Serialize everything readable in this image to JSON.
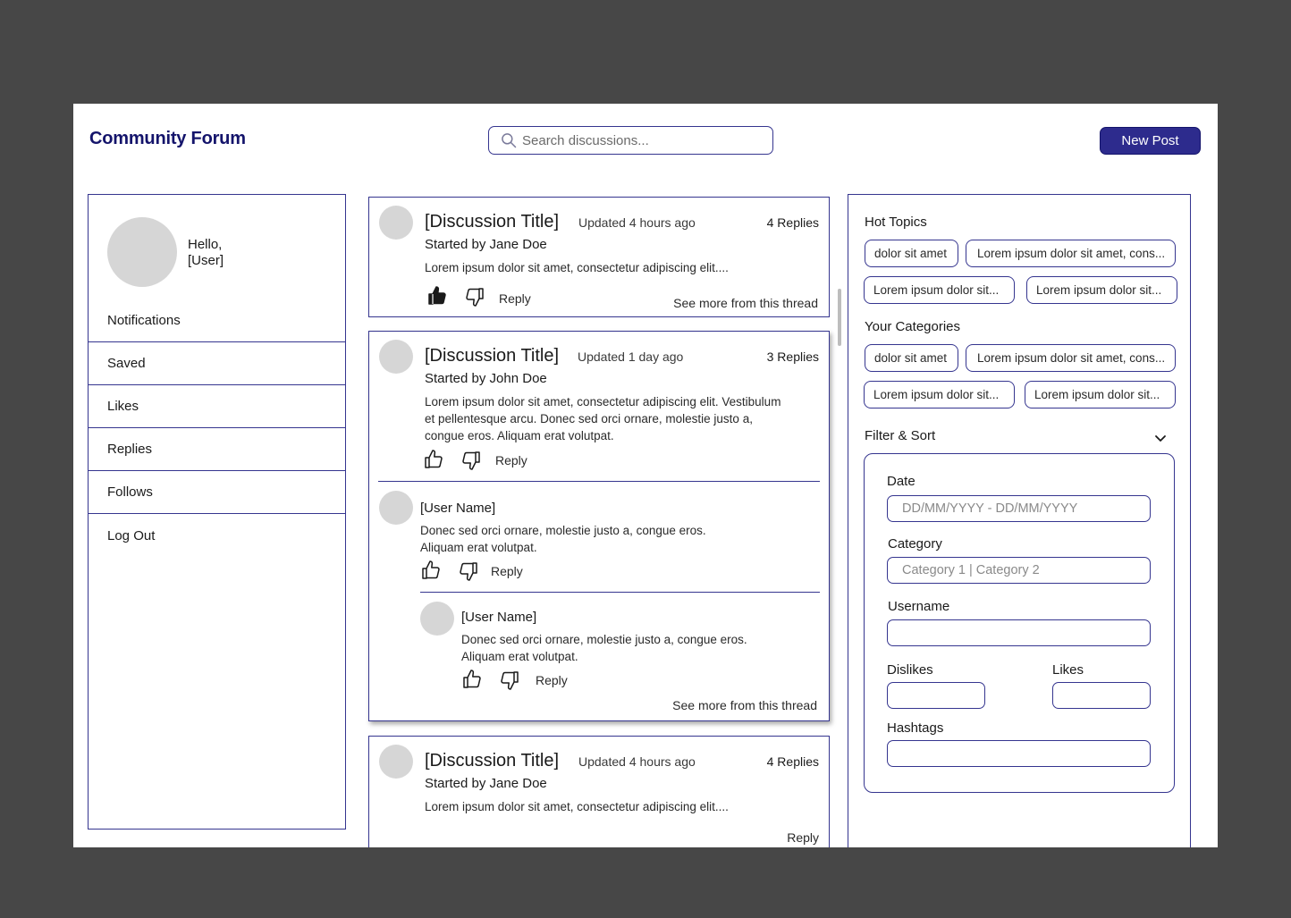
{
  "header": {
    "logo": "Community Forum",
    "search_placeholder": "Search discussions...",
    "new_post_label": "New Post"
  },
  "sidebar": {
    "greeting_line1": "Hello,",
    "greeting_line2": "[User]",
    "items": [
      {
        "label": "Notifications"
      },
      {
        "label": "Saved"
      },
      {
        "label": "Likes"
      },
      {
        "label": "Replies"
      },
      {
        "label": "Follows"
      },
      {
        "label": "Log Out"
      }
    ]
  },
  "posts": [
    {
      "title": "[Discussion Title]",
      "updated": "Updated 4 hours ago",
      "replies": "4 Replies",
      "started_by": "Started by Jane Doe",
      "body": "Lorem ipsum dolor sit amet, consectetur adipiscing elit....",
      "reply_label": "Reply",
      "see_more": "See more from this thread",
      "liked": true
    },
    {
      "title": "[Discussion Title]",
      "updated": "Updated 1 day ago",
      "replies": "3 Replies",
      "started_by": "Started by John Doe",
      "body_lines": [
        "Lorem ipsum dolor sit amet, consectetur adipiscing elit. Vestibulum",
        "et pellentesque arcu. Donec sed orci ornare, molestie justo a,",
        "congue eros. Aliquam erat volutpat."
      ],
      "reply_label": "Reply",
      "comments": [
        {
          "user": "[User Name]",
          "lines": [
            "Donec sed orci ornare, molestie justo a, congue eros.",
            "Aliquam erat volutpat."
          ],
          "reply_label": "Reply"
        },
        {
          "user": "[User Name]",
          "lines": [
            "Donec sed orci ornare, molestie justo a, congue eros.",
            "Aliquam erat volutpat."
          ],
          "reply_label": "Reply"
        }
      ],
      "see_more": "See more from this thread"
    },
    {
      "title": "[Discussion Title]",
      "updated": "Updated 4 hours ago",
      "replies": "4 Replies",
      "started_by": "Started by Jane Doe",
      "body": "Lorem ipsum dolor sit amet, consectetur adipiscing elit....",
      "reply_label": "Reply"
    }
  ],
  "right_panel": {
    "hot_topics_heading": "Hot Topics",
    "hot_topics": [
      "dolor sit amet",
      "Lorem ipsum dolor sit amet, cons...",
      "Lorem ipsum dolor sit...",
      "Lorem ipsum dolor sit..."
    ],
    "categories_heading": "Your Categories",
    "categories": [
      "dolor sit amet",
      "Lorem ipsum dolor sit amet, cons...",
      "Lorem ipsum dolor sit...",
      "Lorem ipsum dolor sit..."
    ],
    "filter_heading": "Filter & Sort",
    "filter": {
      "date_label": "Date",
      "date_placeholder": "DD/MM/YYYY - DD/MM/YYYY",
      "category_label": "Category",
      "category_placeholder": "Category 1 | Category 2",
      "username_label": "Username",
      "dislikes_label": "Dislikes",
      "likes_label": "Likes",
      "hashtags_label": "Hashtags"
    }
  },
  "colors": {
    "background": "#474747",
    "accent": "#2d2b8d",
    "logo": "#14146b",
    "border": "#35358f",
    "avatar": "#d6d6d6"
  }
}
